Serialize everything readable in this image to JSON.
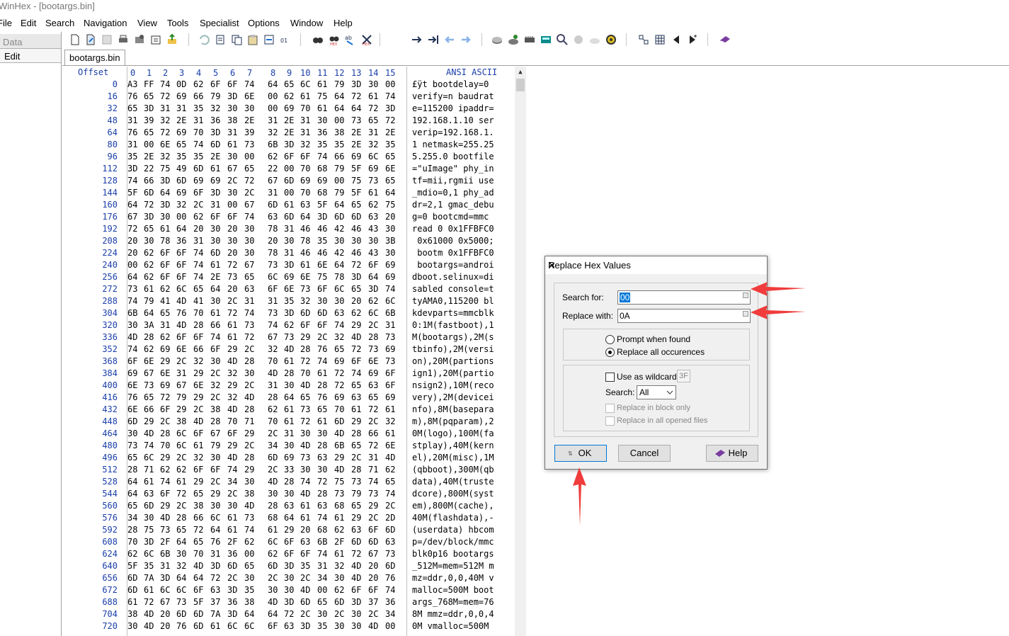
{
  "window": {
    "title": "WinHex - [bootargs.bin]"
  },
  "menu": [
    "File",
    "Edit",
    "Search",
    "Navigation",
    "View",
    "Tools",
    "Specialist",
    "Options",
    "Window",
    "Help"
  ],
  "left_panel": {
    "data_label": "Data",
    "edit_label": "Edit"
  },
  "tab": {
    "label": "bootargs.bin"
  },
  "editor": {
    "offset_header": "Offset",
    "col_headers": [
      "0",
      "1",
      "2",
      "3",
      "4",
      "5",
      "6",
      "7",
      "8",
      "9",
      "10",
      "11",
      "12",
      "13",
      "14",
      "15"
    ],
    "ascii_header": "ANSI ASCII",
    "rows": [
      {
        "offset": "0",
        "hex": [
          "A3",
          "FF",
          "74",
          "0D",
          "62",
          "6F",
          "6F",
          "74",
          "64",
          "65",
          "6C",
          "61",
          "79",
          "3D",
          "30",
          "00"
        ],
        "ascii": "£ÿt bootdelay=0"
      },
      {
        "offset": "16",
        "hex": [
          "76",
          "65",
          "72",
          "69",
          "66",
          "79",
          "3D",
          "6E",
          "00",
          "62",
          "61",
          "75",
          "64",
          "72",
          "61",
          "74"
        ],
        "ascii": "verify=n baudrat"
      },
      {
        "offset": "32",
        "hex": [
          "65",
          "3D",
          "31",
          "31",
          "35",
          "32",
          "30",
          "30",
          "00",
          "69",
          "70",
          "61",
          "64",
          "64",
          "72",
          "3D"
        ],
        "ascii": "e=115200 ipaddr="
      },
      {
        "offset": "48",
        "hex": [
          "31",
          "39",
          "32",
          "2E",
          "31",
          "36",
          "38",
          "2E",
          "31",
          "2E",
          "31",
          "30",
          "00",
          "73",
          "65",
          "72"
        ],
        "ascii": "192.168.1.10 ser"
      },
      {
        "offset": "64",
        "hex": [
          "76",
          "65",
          "72",
          "69",
          "70",
          "3D",
          "31",
          "39",
          "32",
          "2E",
          "31",
          "36",
          "38",
          "2E",
          "31",
          "2E"
        ],
        "ascii": "verip=192.168.1."
      },
      {
        "offset": "80",
        "hex": [
          "31",
          "00",
          "6E",
          "65",
          "74",
          "6D",
          "61",
          "73",
          "6B",
          "3D",
          "32",
          "35",
          "35",
          "2E",
          "32",
          "35"
        ],
        "ascii": "1 netmask=255.25"
      },
      {
        "offset": "96",
        "hex": [
          "35",
          "2E",
          "32",
          "35",
          "35",
          "2E",
          "30",
          "00",
          "62",
          "6F",
          "6F",
          "74",
          "66",
          "69",
          "6C",
          "65"
        ],
        "ascii": "5.255.0 bootfile"
      },
      {
        "offset": "112",
        "hex": [
          "3D",
          "22",
          "75",
          "49",
          "6D",
          "61",
          "67",
          "65",
          "22",
          "00",
          "70",
          "68",
          "79",
          "5F",
          "69",
          "6E"
        ],
        "ascii": "=\"uImage\" phy_in"
      },
      {
        "offset": "128",
        "hex": [
          "74",
          "66",
          "3D",
          "6D",
          "69",
          "69",
          "2C",
          "72",
          "67",
          "6D",
          "69",
          "69",
          "00",
          "75",
          "73",
          "65"
        ],
        "ascii": "tf=mii,rgmii use"
      },
      {
        "offset": "144",
        "hex": [
          "5F",
          "6D",
          "64",
          "69",
          "6F",
          "3D",
          "30",
          "2C",
          "31",
          "00",
          "70",
          "68",
          "79",
          "5F",
          "61",
          "64"
        ],
        "ascii": "_mdio=0,1 phy_ad"
      },
      {
        "offset": "160",
        "hex": [
          "64",
          "72",
          "3D",
          "32",
          "2C",
          "31",
          "00",
          "67",
          "6D",
          "61",
          "63",
          "5F",
          "64",
          "65",
          "62",
          "75"
        ],
        "ascii": "dr=2,1 gmac_debu"
      },
      {
        "offset": "176",
        "hex": [
          "67",
          "3D",
          "30",
          "00",
          "62",
          "6F",
          "6F",
          "74",
          "63",
          "6D",
          "64",
          "3D",
          "6D",
          "6D",
          "63",
          "20"
        ],
        "ascii": "g=0 bootcmd=mmc "
      },
      {
        "offset": "192",
        "hex": [
          "72",
          "65",
          "61",
          "64",
          "20",
          "30",
          "20",
          "30",
          "78",
          "31",
          "46",
          "46",
          "42",
          "46",
          "43",
          "30"
        ],
        "ascii": "read 0 0x1FFBFC0"
      },
      {
        "offset": "208",
        "hex": [
          "20",
          "30",
          "78",
          "36",
          "31",
          "30",
          "30",
          "30",
          "20",
          "30",
          "78",
          "35",
          "30",
          "30",
          "30",
          "3B"
        ],
        "ascii": " 0x61000 0x5000;"
      },
      {
        "offset": "224",
        "hex": [
          "20",
          "62",
          "6F",
          "6F",
          "74",
          "6D",
          "20",
          "30",
          "78",
          "31",
          "46",
          "46",
          "42",
          "46",
          "43",
          "30"
        ],
        "ascii": " bootm 0x1FFBFC0"
      },
      {
        "offset": "240",
        "hex": [
          "00",
          "62",
          "6F",
          "6F",
          "74",
          "61",
          "72",
          "67",
          "73",
          "3D",
          "61",
          "6E",
          "64",
          "72",
          "6F",
          "69"
        ],
        "ascii": " bootargs=androi"
      },
      {
        "offset": "256",
        "hex": [
          "64",
          "62",
          "6F",
          "6F",
          "74",
          "2E",
          "73",
          "65",
          "6C",
          "69",
          "6E",
          "75",
          "78",
          "3D",
          "64",
          "69"
        ],
        "ascii": "dboot.selinux=di"
      },
      {
        "offset": "272",
        "hex": [
          "73",
          "61",
          "62",
          "6C",
          "65",
          "64",
          "20",
          "63",
          "6F",
          "6E",
          "73",
          "6F",
          "6C",
          "65",
          "3D",
          "74"
        ],
        "ascii": "sabled console=t"
      },
      {
        "offset": "288",
        "hex": [
          "74",
          "79",
          "41",
          "4D",
          "41",
          "30",
          "2C",
          "31",
          "31",
          "35",
          "32",
          "30",
          "30",
          "20",
          "62",
          "6C"
        ],
        "ascii": "tyAMA0,115200 bl"
      },
      {
        "offset": "304",
        "hex": [
          "6B",
          "64",
          "65",
          "76",
          "70",
          "61",
          "72",
          "74",
          "73",
          "3D",
          "6D",
          "6D",
          "63",
          "62",
          "6C",
          "6B"
        ],
        "ascii": "kdevparts=mmcblk"
      },
      {
        "offset": "320",
        "hex": [
          "30",
          "3A",
          "31",
          "4D",
          "28",
          "66",
          "61",
          "73",
          "74",
          "62",
          "6F",
          "6F",
          "74",
          "29",
          "2C",
          "31"
        ],
        "ascii": "0:1M(fastboot),1"
      },
      {
        "offset": "336",
        "hex": [
          "4D",
          "28",
          "62",
          "6F",
          "6F",
          "74",
          "61",
          "72",
          "67",
          "73",
          "29",
          "2C",
          "32",
          "4D",
          "28",
          "73"
        ],
        "ascii": "M(bootargs),2M(s"
      },
      {
        "offset": "352",
        "hex": [
          "74",
          "62",
          "69",
          "6E",
          "66",
          "6F",
          "29",
          "2C",
          "32",
          "4D",
          "28",
          "76",
          "65",
          "72",
          "73",
          "69"
        ],
        "ascii": "tbinfo),2M(versi"
      },
      {
        "offset": "368",
        "hex": [
          "6F",
          "6E",
          "29",
          "2C",
          "32",
          "30",
          "4D",
          "28",
          "70",
          "61",
          "72",
          "74",
          "69",
          "6F",
          "6E",
          "73"
        ],
        "ascii": "on),20M(partions"
      },
      {
        "offset": "384",
        "hex": [
          "69",
          "67",
          "6E",
          "31",
          "29",
          "2C",
          "32",
          "30",
          "4D",
          "28",
          "70",
          "61",
          "72",
          "74",
          "69",
          "6F"
        ],
        "ascii": "ign1),20M(partio"
      },
      {
        "offset": "400",
        "hex": [
          "6E",
          "73",
          "69",
          "67",
          "6E",
          "32",
          "29",
          "2C",
          "31",
          "30",
          "4D",
          "28",
          "72",
          "65",
          "63",
          "6F"
        ],
        "ascii": "nsign2),10M(reco"
      },
      {
        "offset": "416",
        "hex": [
          "76",
          "65",
          "72",
          "79",
          "29",
          "2C",
          "32",
          "4D",
          "28",
          "64",
          "65",
          "76",
          "69",
          "63",
          "65",
          "69"
        ],
        "ascii": "very),2M(devicei"
      },
      {
        "offset": "432",
        "hex": [
          "6E",
          "66",
          "6F",
          "29",
          "2C",
          "38",
          "4D",
          "28",
          "62",
          "61",
          "73",
          "65",
          "70",
          "61",
          "72",
          "61"
        ],
        "ascii": "nfo),8M(basepara"
      },
      {
        "offset": "448",
        "hex": [
          "6D",
          "29",
          "2C",
          "38",
          "4D",
          "28",
          "70",
          "71",
          "70",
          "61",
          "72",
          "61",
          "6D",
          "29",
          "2C",
          "32"
        ],
        "ascii": "m),8M(pqparam),2"
      },
      {
        "offset": "464",
        "hex": [
          "30",
          "4D",
          "28",
          "6C",
          "6F",
          "67",
          "6F",
          "29",
          "2C",
          "31",
          "30",
          "30",
          "4D",
          "28",
          "66",
          "61"
        ],
        "ascii": "0M(logo),100M(fa"
      },
      {
        "offset": "480",
        "hex": [
          "73",
          "74",
          "70",
          "6C",
          "61",
          "79",
          "29",
          "2C",
          "34",
          "30",
          "4D",
          "28",
          "6B",
          "65",
          "72",
          "6E"
        ],
        "ascii": "stplay),40M(kern"
      },
      {
        "offset": "496",
        "hex": [
          "65",
          "6C",
          "29",
          "2C",
          "32",
          "30",
          "4D",
          "28",
          "6D",
          "69",
          "73",
          "63",
          "29",
          "2C",
          "31",
          "4D"
        ],
        "ascii": "el),20M(misc),1M"
      },
      {
        "offset": "512",
        "hex": [
          "28",
          "71",
          "62",
          "62",
          "6F",
          "6F",
          "74",
          "29",
          "2C",
          "33",
          "30",
          "30",
          "4D",
          "28",
          "71",
          "62"
        ],
        "ascii": "(qbboot),300M(qb"
      },
      {
        "offset": "528",
        "hex": [
          "64",
          "61",
          "74",
          "61",
          "29",
          "2C",
          "34",
          "30",
          "4D",
          "28",
          "74",
          "72",
          "75",
          "73",
          "74",
          "65"
        ],
        "ascii": "data),40M(truste"
      },
      {
        "offset": "544",
        "hex": [
          "64",
          "63",
          "6F",
          "72",
          "65",
          "29",
          "2C",
          "38",
          "30",
          "30",
          "4D",
          "28",
          "73",
          "79",
          "73",
          "74"
        ],
        "ascii": "dcore),800M(syst"
      },
      {
        "offset": "560",
        "hex": [
          "65",
          "6D",
          "29",
          "2C",
          "38",
          "30",
          "30",
          "4D",
          "28",
          "63",
          "61",
          "63",
          "68",
          "65",
          "29",
          "2C"
        ],
        "ascii": "em),800M(cache),"
      },
      {
        "offset": "576",
        "hex": [
          "34",
          "30",
          "4D",
          "28",
          "66",
          "6C",
          "61",
          "73",
          "68",
          "64",
          "61",
          "74",
          "61",
          "29",
          "2C",
          "2D"
        ],
        "ascii": "40M(flashdata),-"
      },
      {
        "offset": "592",
        "hex": [
          "28",
          "75",
          "73",
          "65",
          "72",
          "64",
          "61",
          "74",
          "61",
          "29",
          "20",
          "68",
          "62",
          "63",
          "6F",
          "6D"
        ],
        "ascii": "(userdata) hbcom"
      },
      {
        "offset": "608",
        "hex": [
          "70",
          "3D",
          "2F",
          "64",
          "65",
          "76",
          "2F",
          "62",
          "6C",
          "6F",
          "63",
          "6B",
          "2F",
          "6D",
          "6D",
          "63"
        ],
        "ascii": "p=/dev/block/mmc"
      },
      {
        "offset": "624",
        "hex": [
          "62",
          "6C",
          "6B",
          "30",
          "70",
          "31",
          "36",
          "00",
          "62",
          "6F",
          "6F",
          "74",
          "61",
          "72",
          "67",
          "73"
        ],
        "ascii": "blk0p16 bootargs"
      },
      {
        "offset": "640",
        "hex": [
          "5F",
          "35",
          "31",
          "32",
          "4D",
          "3D",
          "6D",
          "65",
          "6D",
          "3D",
          "35",
          "31",
          "32",
          "4D",
          "20",
          "6D"
        ],
        "ascii": "_512M=mem=512M m"
      },
      {
        "offset": "656",
        "hex": [
          "6D",
          "7A",
          "3D",
          "64",
          "64",
          "72",
          "2C",
          "30",
          "2C",
          "30",
          "2C",
          "34",
          "30",
          "4D",
          "20",
          "76"
        ],
        "ascii": "mz=ddr,0,0,40M v"
      },
      {
        "offset": "672",
        "hex": [
          "6D",
          "61",
          "6C",
          "6C",
          "6F",
          "63",
          "3D",
          "35",
          "30",
          "30",
          "4D",
          "00",
          "62",
          "6F",
          "6F",
          "74"
        ],
        "ascii": "malloc=500M boot"
      },
      {
        "offset": "688",
        "hex": [
          "61",
          "72",
          "67",
          "73",
          "5F",
          "37",
          "36",
          "38",
          "4D",
          "3D",
          "6D",
          "65",
          "6D",
          "3D",
          "37",
          "36"
        ],
        "ascii": "args_768M=mem=76"
      },
      {
        "offset": "704",
        "hex": [
          "38",
          "4D",
          "20",
          "6D",
          "6D",
          "7A",
          "3D",
          "64",
          "64",
          "72",
          "2C",
          "30",
          "2C",
          "30",
          "2C",
          "34"
        ],
        "ascii": "8M mmz=ddr,0,0,4"
      },
      {
        "offset": "720",
        "hex": [
          "30",
          "4D",
          "20",
          "76",
          "6D",
          "61",
          "6C",
          "6C",
          "6F",
          "63",
          "3D",
          "35",
          "30",
          "30",
          "4D",
          "00"
        ],
        "ascii": "0M vmalloc=500M"
      }
    ]
  },
  "dialog": {
    "title": "Replace Hex Values",
    "search_label": "Search for:",
    "search_value": "00",
    "replace_label": "Replace with:",
    "replace_value": "0A",
    "prompt_label": "Prompt when found",
    "replace_all_label": "Replace all occurences",
    "wildcard_label": "Use as wildcard:",
    "wildcard_value": "3F",
    "search_scope_label": "Search:",
    "search_scope_value": "All",
    "block_only_label": "Replace in block only",
    "all_files_label": "Replace in all opened files",
    "ok_label": "OK",
    "cancel_label": "Cancel",
    "help_label": "Help",
    "replace_all_selected": true
  },
  "colors": {
    "accent": "#0078d7",
    "offset_blue": "#1a3ea8",
    "annotation_red": "#f03c3c"
  }
}
